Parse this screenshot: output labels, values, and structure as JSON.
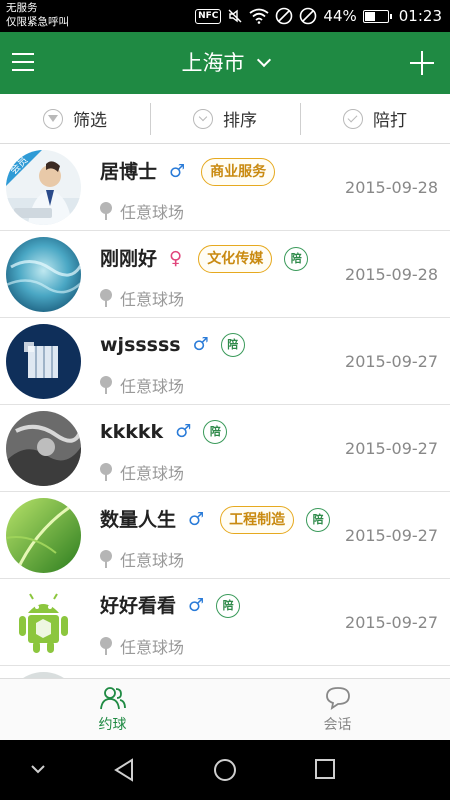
{
  "status_bar": {
    "carrier_line1": "无服务",
    "carrier_line2": "仅限紧急呼叫",
    "nfc": "NFC",
    "battery_percent": "44%",
    "battery_level": 0.44,
    "time": "01:23"
  },
  "header": {
    "city": "上海市"
  },
  "filters": [
    {
      "label": "筛选",
      "icon": "funnel-icon"
    },
    {
      "label": "排序",
      "icon": "sort-down-icon"
    },
    {
      "label": "陪打",
      "icon": "check-circle-icon"
    }
  ],
  "list": [
    {
      "name": "居博士",
      "gender": "♂",
      "gender_type": "m",
      "tag": "商业服务",
      "pei": "",
      "location": "任意球场",
      "date": "2015-09-28",
      "vip": "会员"
    },
    {
      "name": "刚刚好",
      "gender": "♀",
      "gender_type": "f",
      "tag": "文化传媒",
      "pei": "陪",
      "location": "任意球场",
      "date": "2015-09-28",
      "vip": ""
    },
    {
      "name": "wjsssss",
      "gender": "♂",
      "gender_type": "m",
      "tag": "",
      "pei": "陪",
      "location": "任意球场",
      "date": "2015-09-27",
      "vip": ""
    },
    {
      "name": "kkkkk",
      "gender": "♂",
      "gender_type": "m",
      "tag": "",
      "pei": "陪",
      "location": "任意球场",
      "date": "2015-09-27",
      "vip": ""
    },
    {
      "name": "数量人生",
      "gender": "♂",
      "gender_type": "m",
      "tag": "工程制造",
      "pei": "陪",
      "location": "任意球场",
      "date": "2015-09-27",
      "vip": ""
    },
    {
      "name": "好好看看",
      "gender": "♂",
      "gender_type": "m",
      "tag": "",
      "pei": "陪",
      "location": "任意球场",
      "date": "2015-09-27",
      "vip": ""
    }
  ],
  "tabs": [
    {
      "label": "约球",
      "icon": "people-icon",
      "active": true
    },
    {
      "label": "会话",
      "icon": "chat-bubble-icon",
      "active": false
    }
  ],
  "colors": {
    "brand_green": "#1f8a43",
    "tag_orange": "#e6a91f",
    "male_blue": "#2a7bd8",
    "female_pink": "#e0457b"
  }
}
